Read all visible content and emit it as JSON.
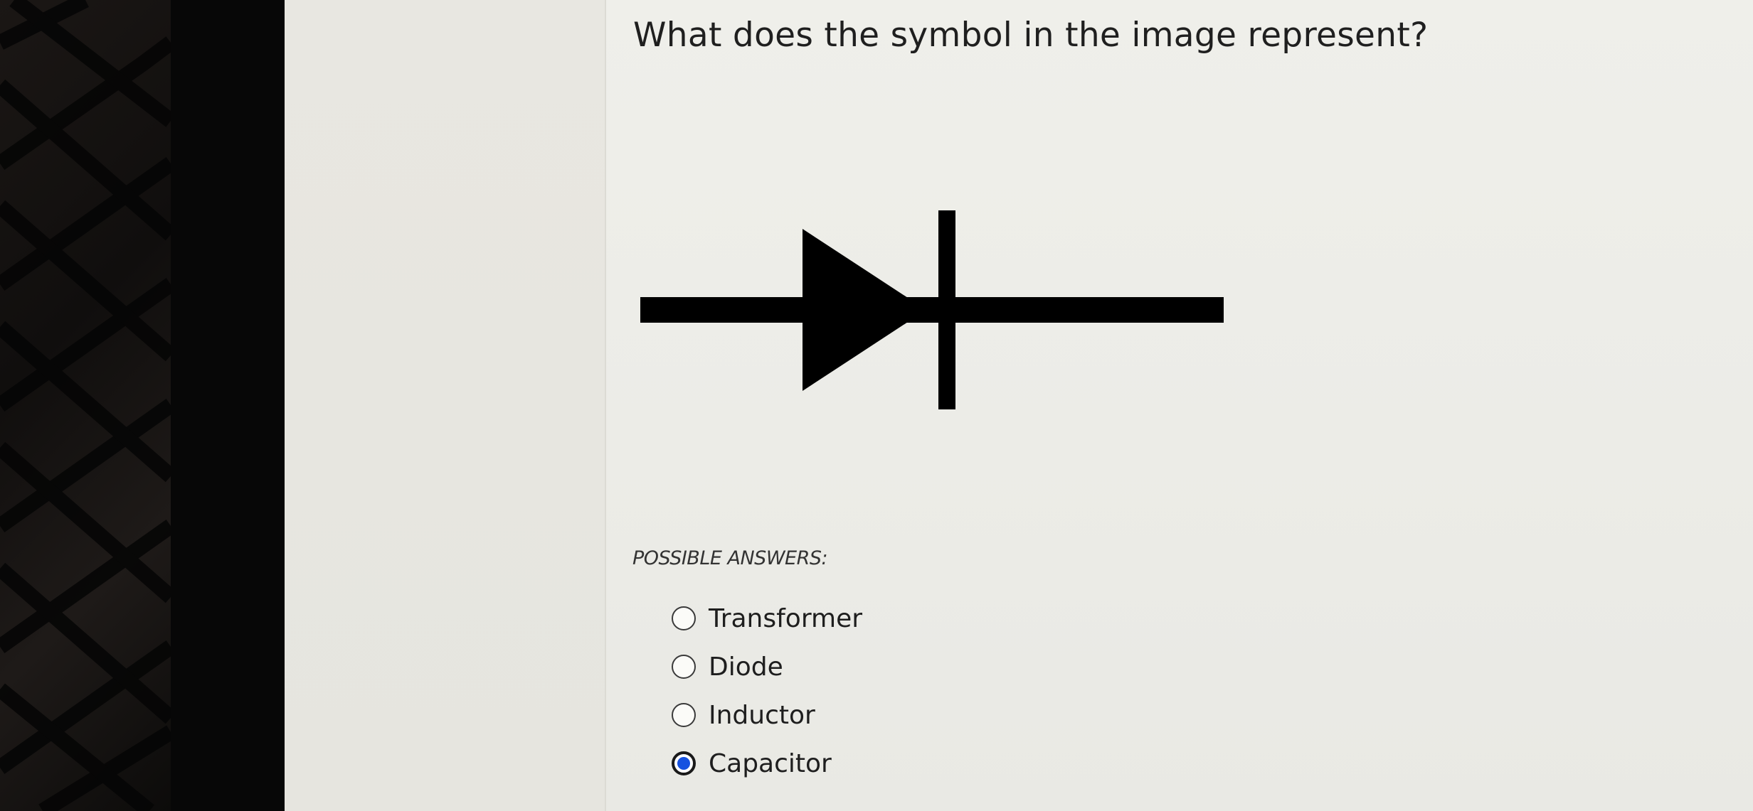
{
  "question": {
    "text": "What does the symbol in the image represent?"
  },
  "figure": {
    "symbol_icon": "diode-symbol"
  },
  "answers": {
    "label": "POSSIBLE ANSWERS:",
    "options": [
      {
        "label": "Transformer",
        "selected": false
      },
      {
        "label": "Diode",
        "selected": false
      },
      {
        "label": "Inductor",
        "selected": false
      },
      {
        "label": "Capacitor",
        "selected": true
      }
    ]
  },
  "colors": {
    "radio_selected_fill": "#1652e0",
    "text": "#1e1e1e",
    "background": "#ecece7"
  }
}
